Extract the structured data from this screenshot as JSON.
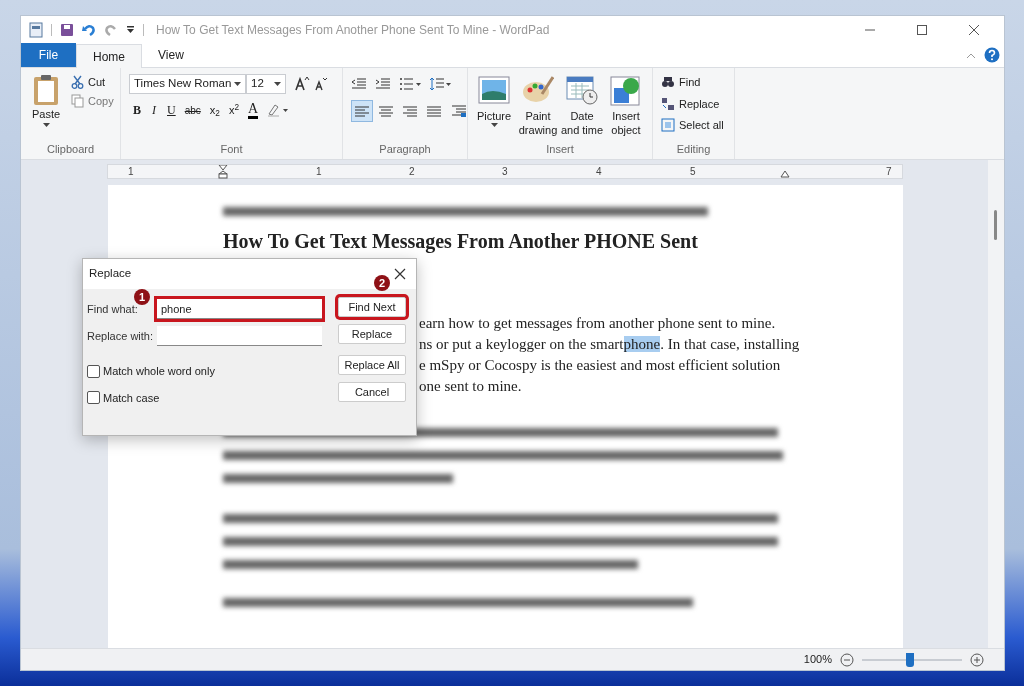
{
  "window": {
    "title": "How To Get Text Messages From Another Phone Sent To Mine - WordPad"
  },
  "tabs": [
    {
      "label": "File",
      "kind": "file",
      "selected": false
    },
    {
      "label": "Home",
      "kind": "tab",
      "selected": true
    },
    {
      "label": "View",
      "kind": "tab",
      "selected": false
    }
  ],
  "ribbon": {
    "clipboard": {
      "paste": "Paste",
      "cut": "Cut",
      "copy": "Copy",
      "label": "Clipboard"
    },
    "font": {
      "font_name": "Times New Roman",
      "font_size": "12",
      "bold": "B",
      "italic": "I",
      "underline": "U",
      "strikethrough": "abc",
      "subscript": "x$_{2}$",
      "superscript": "x$^{2}$",
      "color_letter": "A",
      "label": "Font"
    },
    "paragraph": {
      "alignments": [
        {
          "kind": "left",
          "selected": true
        },
        {
          "kind": "center",
          "selected": false
        },
        {
          "kind": "right",
          "selected": false
        },
        {
          "kind": "justify",
          "selected": false
        }
      ],
      "label": "Paragraph"
    },
    "insert": {
      "items": [
        {
          "kind": "picture",
          "label": "Picture",
          "caret": true
        },
        {
          "kind": "paint",
          "label": "Paint drawing",
          "caret": false
        },
        {
          "kind": "date",
          "label": "Date and time",
          "caret": false
        },
        {
          "kind": "object",
          "label": "Insert object",
          "caret": false
        }
      ],
      "label": "Insert"
    },
    "editing": {
      "items": [
        {
          "kind": "find",
          "label": "Find"
        },
        {
          "kind": "replace",
          "label": "Replace"
        },
        {
          "kind": "select",
          "label": "Select all"
        }
      ],
      "label": "Editing"
    }
  },
  "ruler": {
    "numbers": [
      "1",
      "1",
      "2",
      "3",
      "4",
      "5",
      "7"
    ]
  },
  "document": {
    "heading": "How To Get Text Messages From Another PHONE Sent",
    "lines": [
      {
        "before": "earn how to get messages from another phone sent to mine."
      },
      {
        "before": "ns or put a keylogger on the smart",
        "highlight": "phone",
        "after": ". In that case, installing"
      },
      {
        "before": "e mSpy or Cocospy is the easiest and most efficient solution"
      },
      {
        "before": "one sent to mine."
      }
    ]
  },
  "dialog": {
    "title": "Replace",
    "find_label": "Find what:",
    "find_value": "phone",
    "replace_label": "Replace with:",
    "options": [
      {
        "label": "Match whole word only",
        "checked": false
      },
      {
        "label": "Match case",
        "checked": false
      }
    ],
    "buttons": [
      {
        "label": "Find Next",
        "annotated": true
      },
      {
        "label": "Replace",
        "annotated": false
      },
      {
        "label": "Replace All",
        "annotated": false
      },
      {
        "label": "Cancel",
        "annotated": false
      }
    ],
    "annotations": [
      "1",
      "2"
    ]
  },
  "status_bar": {
    "zoom": "100%",
    "zoom_slider": {
      "level": 0.48
    }
  }
}
